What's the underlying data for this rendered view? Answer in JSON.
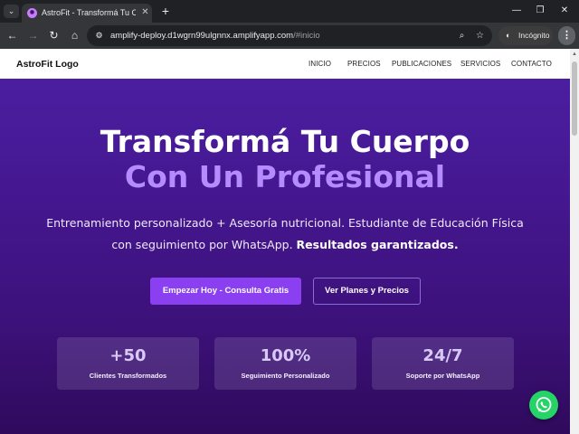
{
  "browser": {
    "tab": {
      "title": "AstroFit - Transformá Tu Cuerpo",
      "favicon_icon": "astrofit-favicon",
      "close_icon": "close-icon"
    },
    "url": {
      "host": "amplify-deploy.d1wgrn99ulgnnx.amplifyapp.com",
      "path": "/#inicio"
    },
    "incognito_label": "Incógnito"
  },
  "site": {
    "logo": "AstroFit Logo",
    "nav": [
      "INICIO",
      "PRECIOS",
      "PUBLICACIONES",
      "SERVICIOS",
      "CONTACTO"
    ]
  },
  "hero": {
    "title_line1": "Transformá Tu Cuerpo",
    "title_line2": "Con Un Profesional",
    "subtitle_line1": "Entrenamiento personalizado + Asesoría nutricional. Estudiante de Educación Física",
    "subtitle_line2_prefix": "con seguimiento por WhatsApp. ",
    "subtitle_line2_bold": "Resultados garantizados.",
    "cta_primary": "Empezar Hoy - Consulta Gratis",
    "cta_secondary": "Ver Planes y Precios"
  },
  "stats": [
    {
      "value": "+50",
      "label": "Clientes Transformados"
    },
    {
      "value": "100%",
      "label": "Seguimiento Personalizado"
    },
    {
      "value": "24/7",
      "label": "Soporte por WhatsApp"
    }
  ],
  "colors": {
    "accent": "#8a3ff0",
    "title_highlight": "#b58cff",
    "hero_gradient_top": "#4b1ea1",
    "hero_gradient_bottom": "#2f0a5c",
    "whatsapp": "#25d366"
  }
}
